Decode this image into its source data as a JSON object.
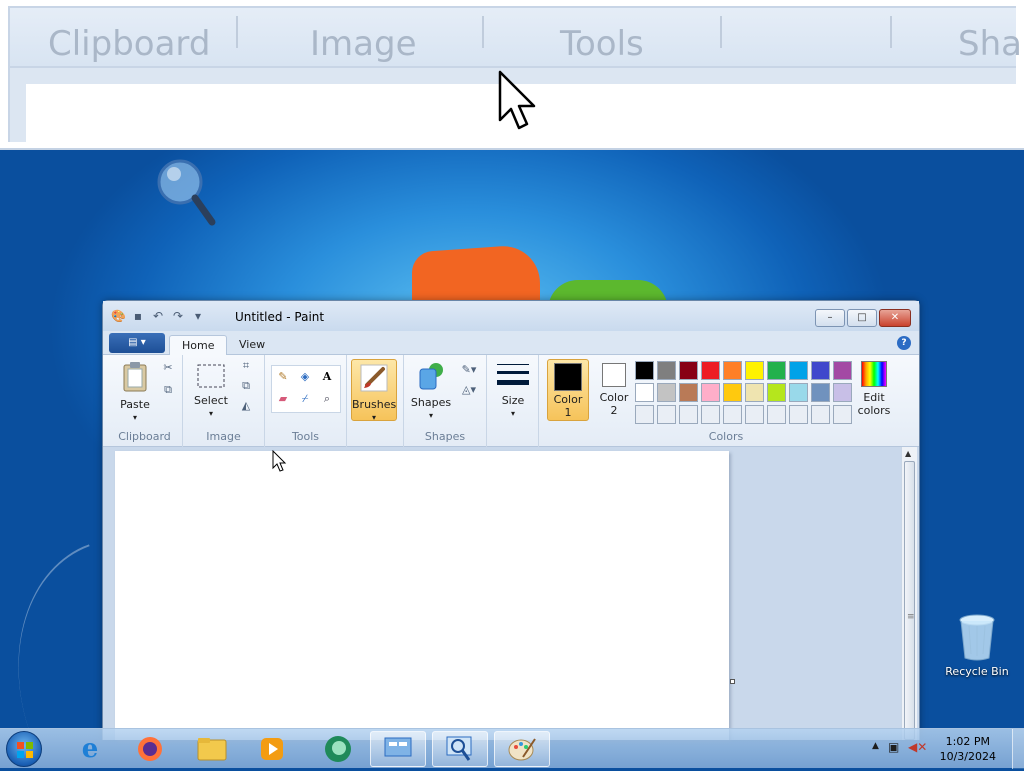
{
  "magnifier": {
    "labels": [
      "Clipboard",
      "Image",
      "Tools",
      "Sha"
    ]
  },
  "paint": {
    "title": "Untitled - Paint",
    "tabs": [
      "Home",
      "View"
    ],
    "window_controls": {
      "minimize": "–",
      "maximize": "□",
      "close": "✕"
    },
    "help": "?",
    "groups": {
      "clipboard": {
        "label": "Clipboard",
        "paste": "Paste"
      },
      "image": {
        "label": "Image",
        "select": "Select"
      },
      "tools": {
        "label": "Tools"
      },
      "brushes": {
        "label": "Brushes"
      },
      "shapes": {
        "label": "Shapes",
        "shapes_btn": "Shapes"
      },
      "size": {
        "label": "Size"
      },
      "colors": {
        "label": "Colors",
        "color1": "Color 1",
        "color1_line1": "Color",
        "color1_line2": "1",
        "color2_line1": "Color",
        "color2_line2": "2",
        "edit_line1": "Edit",
        "edit_line2": "colors",
        "row1": [
          "#000000",
          "#7f7f7f",
          "#880015",
          "#ed1c24",
          "#ff7f27",
          "#fff200",
          "#22b14c",
          "#00a2e8",
          "#3f48cc",
          "#a349a4"
        ],
        "row2": [
          "#ffffff",
          "#c3c3c3",
          "#b97a57",
          "#ffaec9",
          "#ffc90e",
          "#efe4b0",
          "#b5e61d",
          "#99d9ea",
          "#7092be",
          "#c8bfe7"
        ],
        "primary": "#000000",
        "secondary": "#ffffff"
      }
    }
  },
  "desktop": {
    "recycle_bin": "Recycle Bin"
  },
  "taskbar": {
    "time": "1:02 PM",
    "date": "10/3/2024"
  }
}
